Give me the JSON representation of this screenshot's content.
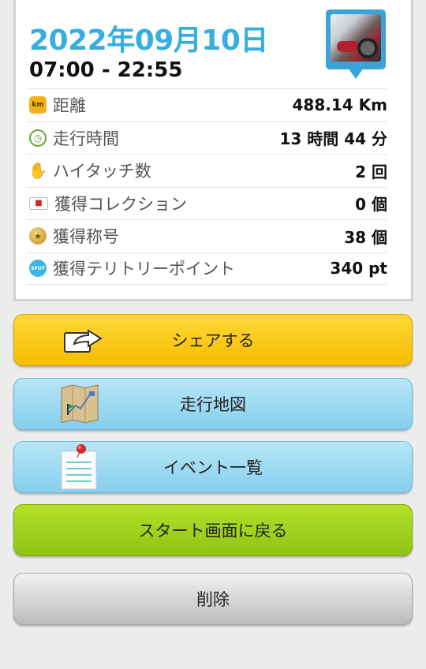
{
  "summary": {
    "date": "2022年09月10日",
    "time_range": "07:00 - 22:55",
    "photo": "motorcycle-photo"
  },
  "stats": [
    {
      "icon": "km-icon",
      "label": "距離",
      "value": "488.14 Km"
    },
    {
      "icon": "clock-icon",
      "label": "走行時間",
      "value": "13 時間 44 分"
    },
    {
      "icon": "high-five-icon",
      "label": "ハイタッチ数",
      "value": "2 回"
    },
    {
      "icon": "car-card-icon",
      "label": "獲得コレクション",
      "value": "0 個"
    },
    {
      "icon": "medal-icon",
      "label": "獲得称号",
      "value": "38 個"
    },
    {
      "icon": "spot-icon",
      "label": "獲得テリトリーポイント",
      "value": "340 pt"
    }
  ],
  "icon_text": {
    "km": "km",
    "spot": "SPOT"
  },
  "buttons": {
    "share": "シェアする",
    "map": "走行地図",
    "events": "イベント一覧",
    "start": "スタート画面に戻る",
    "delete": "削除"
  },
  "colors": {
    "date": "#38aee0",
    "share": "#f4bd00",
    "map": "#86cfee",
    "start": "#8fc412",
    "delete": "#bcbcbc"
  }
}
